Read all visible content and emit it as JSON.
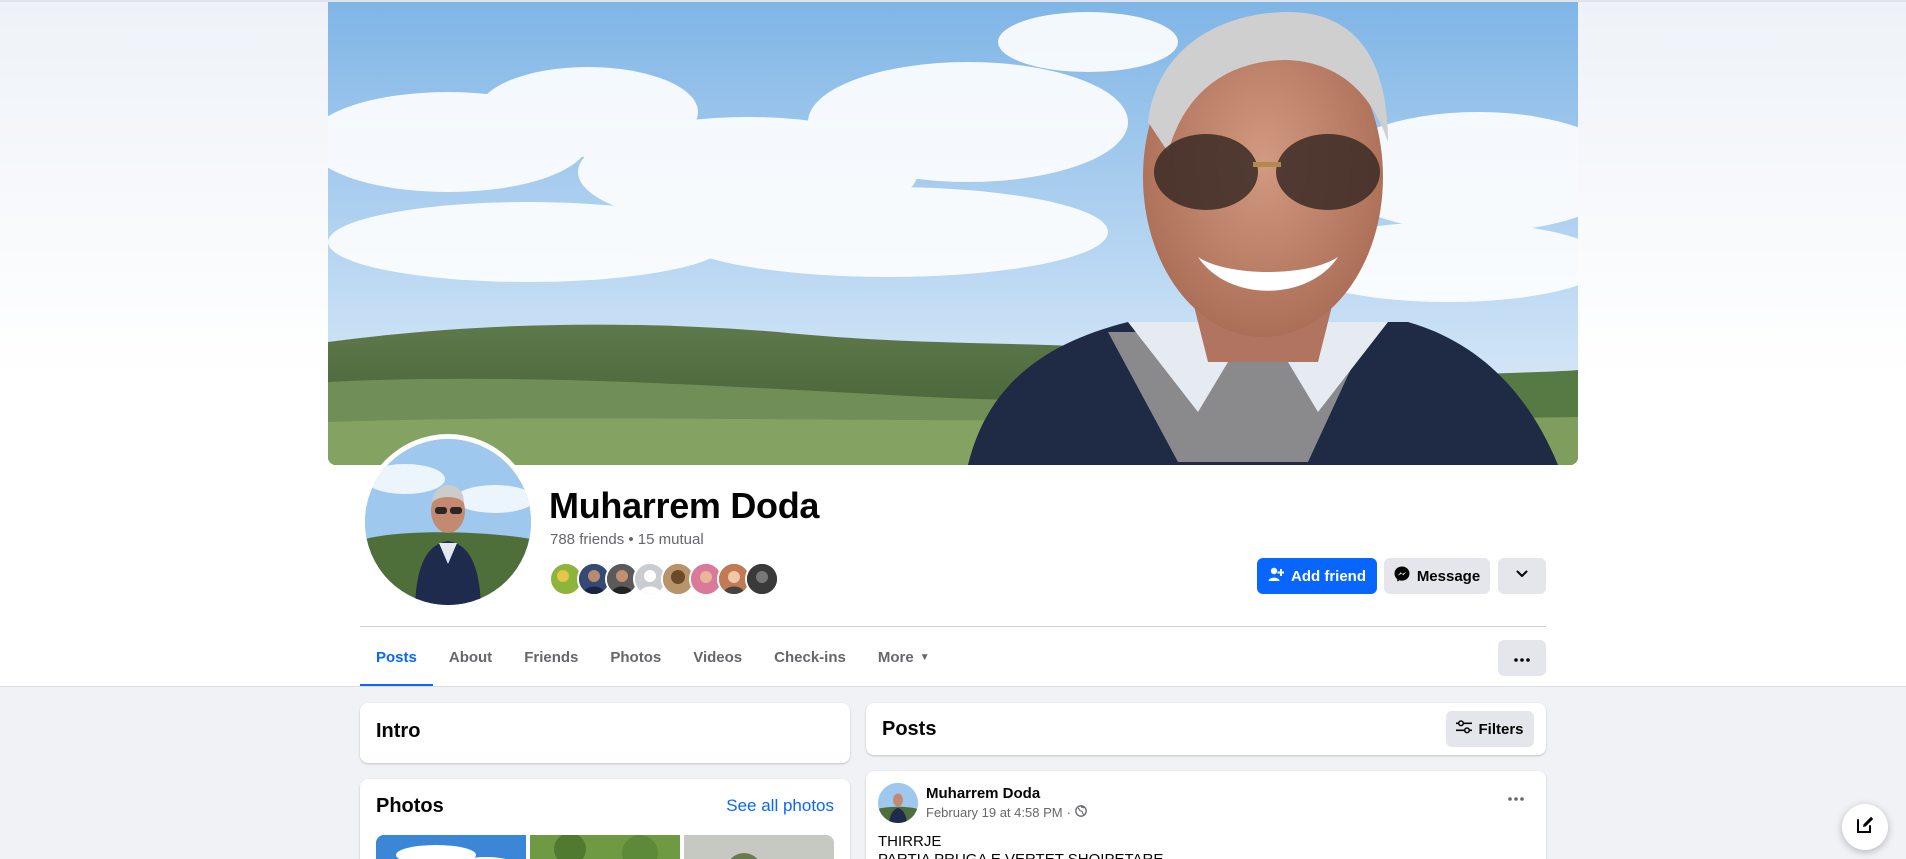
{
  "profile": {
    "name": "Muharrem Doda",
    "friends_summary": "788 friends • 15 mutual",
    "mutual_friend_avatars": [
      "friend-avatar-1",
      "friend-avatar-2",
      "friend-avatar-3",
      "friend-avatar-4",
      "friend-avatar-5",
      "friend-avatar-6",
      "friend-avatar-7",
      "friend-avatar-8"
    ]
  },
  "actions": {
    "add_friend": "Add friend",
    "message": "Message"
  },
  "tabs": [
    {
      "label": "Posts",
      "active": true
    },
    {
      "label": "About"
    },
    {
      "label": "Friends"
    },
    {
      "label": "Photos"
    },
    {
      "label": "Videos"
    },
    {
      "label": "Check-ins"
    },
    {
      "label": "More"
    }
  ],
  "intro": {
    "title": "Intro"
  },
  "photos": {
    "title": "Photos",
    "see_all": "See all photos"
  },
  "posts": {
    "title": "Posts",
    "filters_label": "Filters",
    "items": [
      {
        "author": "Muharrem Doda",
        "timestamp": "February 19 at 4:58 PM",
        "audience": "·",
        "text_lines": [
          "THIRRJE",
          "PARTIA PRUGA E VERTET SHQIPETARE"
        ]
      }
    ]
  },
  "colors": {
    "accent": "#0866ff",
    "secondary_button": "#e4e6eb",
    "page_bg": "#f0f2f5",
    "muted_text": "#65676b"
  },
  "icons": {
    "add_friend": "person-plus-icon",
    "message": "messenger-icon",
    "dropdown": "chevron-down-icon",
    "more": "ellipsis-icon",
    "filters": "sliders-icon",
    "audience": "globe-icon",
    "compose": "compose-icon"
  }
}
